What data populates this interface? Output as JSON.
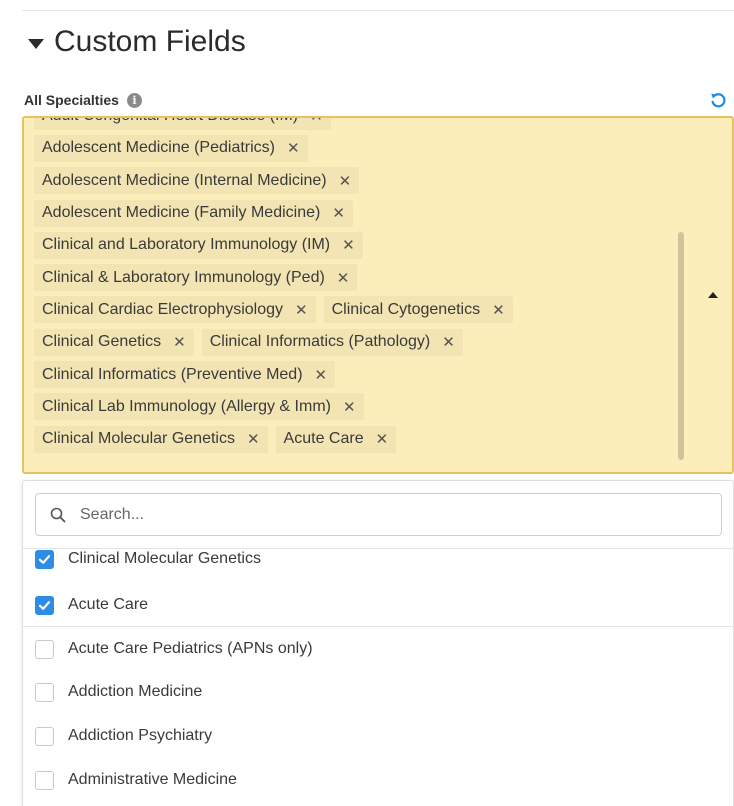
{
  "section": {
    "title": "Custom Fields"
  },
  "field": {
    "label": "All Specialties"
  },
  "tag_rows": [
    [
      "Adult Congenital Heart Disease (IM)"
    ],
    [
      "Adolescent Medicine (Pediatrics)"
    ],
    [
      "Adolescent Medicine (Internal Medicine)"
    ],
    [
      "Adolescent Medicine (Family Medicine)"
    ],
    [
      "Clinical and Laboratory Immunology (IM)"
    ],
    [
      "Clinical & Laboratory Immunology (Ped)"
    ],
    [
      "Clinical Cardiac Electrophysiology",
      "Clinical Cytogenetics"
    ],
    [
      "Clinical Genetics",
      "Clinical Informatics (Pathology)"
    ],
    [
      "Clinical Informatics (Preventive Med)"
    ],
    [
      "Clinical Lab Immunology (Allergy & Imm)"
    ],
    [
      "Clinical Molecular Genetics",
      "Acute Care"
    ]
  ],
  "tag_remove_symbol": "✕",
  "search": {
    "placeholder": "Search..."
  },
  "selected_options": [
    {
      "label": "Clinical Molecular Genetics",
      "checked": true
    },
    {
      "label": "Acute Care",
      "checked": true
    }
  ],
  "other_options": [
    {
      "label": "Acute Care Pediatrics (APNs only)",
      "checked": false
    },
    {
      "label": "Addiction Medicine",
      "checked": false
    },
    {
      "label": "Addiction Psychiatry",
      "checked": false
    },
    {
      "label": "Administrative Medicine",
      "checked": false
    }
  ],
  "colors": {
    "tag_box_bg": "#fbeebb",
    "tag_box_border": "#e6c35c",
    "tag_bg": "#f3e4b3",
    "checkbox_checked": "#2d8ce5",
    "reset_icon": "#1a8ce8"
  },
  "icons": {
    "section_toggle": "caret-down-icon",
    "info": "info-icon",
    "reset": "reset-icon",
    "search": "search-icon",
    "collapse": "caret-up-icon",
    "remove": "close-icon",
    "check": "check-icon"
  }
}
